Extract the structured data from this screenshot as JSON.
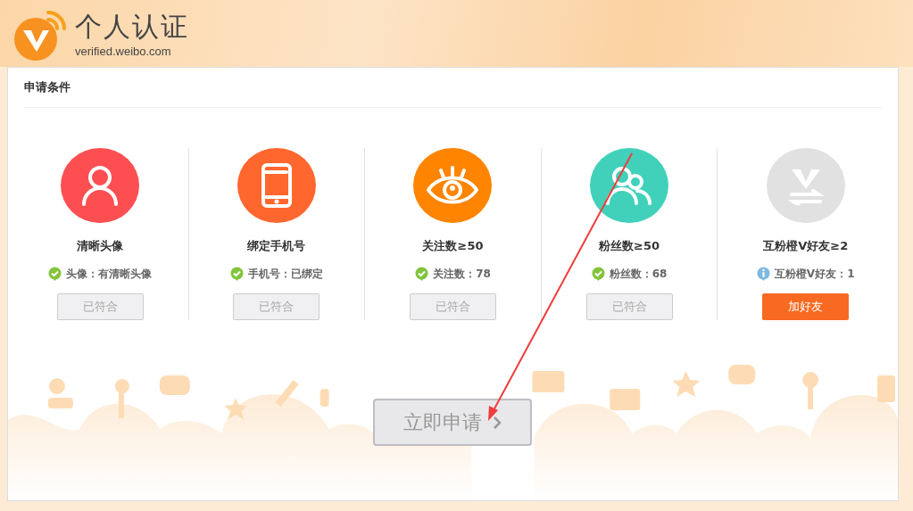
{
  "header": {
    "title": "个人认证",
    "domain": "verified.weibo.com"
  },
  "section_title": "申请条件",
  "items": [
    {
      "kind": "avatar",
      "color": "#fd4f52",
      "title": "清晰头像",
      "met": true,
      "status": "头像：有清晰头像",
      "action": {
        "label": "已符合",
        "disabled": true
      }
    },
    {
      "kind": "phone",
      "color": "#ff672e",
      "title": "绑定手机号",
      "met": true,
      "status": "手机号：已绑定",
      "action": {
        "label": "已符合",
        "disabled": true
      }
    },
    {
      "kind": "eye",
      "color": "#ff8400",
      "title": "关注数≥50",
      "met": true,
      "status": "关注数：78",
      "action": {
        "label": "已符合",
        "disabled": true
      }
    },
    {
      "kind": "fans",
      "color": "#41d1bb",
      "title": "粉丝数≥50",
      "met": true,
      "status": "粉丝数：68",
      "action": {
        "label": "已符合",
        "disabled": true
      }
    },
    {
      "kind": "mutual",
      "color": "#e1e1e1",
      "title": "互粉橙V好友≥2",
      "met": false,
      "status": "互粉橙V好友：1",
      "action": {
        "label": "加好友",
        "disabled": false
      }
    }
  ],
  "apply_button": {
    "label": "立即申请",
    "disabled": true
  }
}
